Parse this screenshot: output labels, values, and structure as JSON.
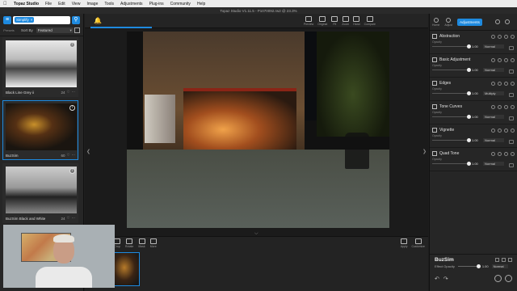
{
  "menubar": {
    "app": "Topaz Studio",
    "items": [
      "File",
      "Edit",
      "View",
      "Image",
      "Tools",
      "Adjustments",
      "Plug-ins",
      "Community",
      "Help"
    ]
  },
  "window": {
    "title": "Topaz Studio V1.11.5 - P1070092.rw2 @ 23.3%"
  },
  "left": {
    "search_chip": "Simplify",
    "presets_label": "Presets",
    "sort_label": "Sort By",
    "sort_value": "Featured",
    "presets": [
      {
        "name": "Black Line Grey ii",
        "count": "24",
        "style": "bw"
      },
      {
        "name": "BuzSim",
        "count": "60",
        "style": "color"
      },
      {
        "name": "BuzSim Black and White",
        "count": "24",
        "style": "bw2"
      }
    ]
  },
  "center": {
    "tools": [
      "Preview",
      "Original",
      "Fit",
      "Zoom",
      "Hand",
      "Compare"
    ],
    "bottom_tools": [
      "Crop",
      "Rotate",
      "Mask",
      "More"
    ],
    "bottom_right_tools": [
      "Apply",
      "Customize"
    ]
  },
  "right": {
    "tabs": [
      "Home",
      "Adjust"
    ],
    "active_tab": "Adjustments",
    "adjustments": [
      {
        "name": "Abstraction",
        "opacity_label": "Opacity",
        "value": "1.00",
        "mode": "Normal"
      },
      {
        "name": "Basic Adjustment",
        "opacity_label": "Opacity",
        "value": "1.00",
        "mode": "Normal"
      },
      {
        "name": "Edges",
        "opacity_label": "Opacity",
        "value": "1.00",
        "mode": "Multiply"
      },
      {
        "name": "Tone Curves",
        "opacity_label": "Opacity",
        "value": "1.00",
        "mode": "Normal"
      },
      {
        "name": "Vignette",
        "opacity_label": "Opacity",
        "value": "1.00",
        "mode": "Normal"
      },
      {
        "name": "Quad Tone",
        "opacity_label": "Opacity",
        "value": "1.00",
        "mode": "Normal"
      }
    ],
    "footer": {
      "preset_name": "BuzSim",
      "effect_label": "Effect Opacity",
      "effect_value": "1.00",
      "effect_mode": "Normal"
    }
  }
}
